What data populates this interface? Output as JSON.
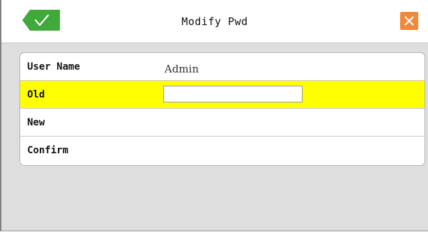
{
  "dialog": {
    "title": "Modify Pwd",
    "ok_icon": "check-icon",
    "close_icon": "close-icon",
    "accent_ok": "#3fa93a",
    "accent_close": "#f08a3a",
    "selected_row_color": "#ffff00"
  },
  "form": {
    "rows": [
      {
        "label": "User Name",
        "value": "Admin"
      },
      {
        "label": "Old",
        "value": ""
      },
      {
        "label": "New",
        "value": ""
      },
      {
        "label": "Confirm",
        "value": ""
      }
    ]
  }
}
